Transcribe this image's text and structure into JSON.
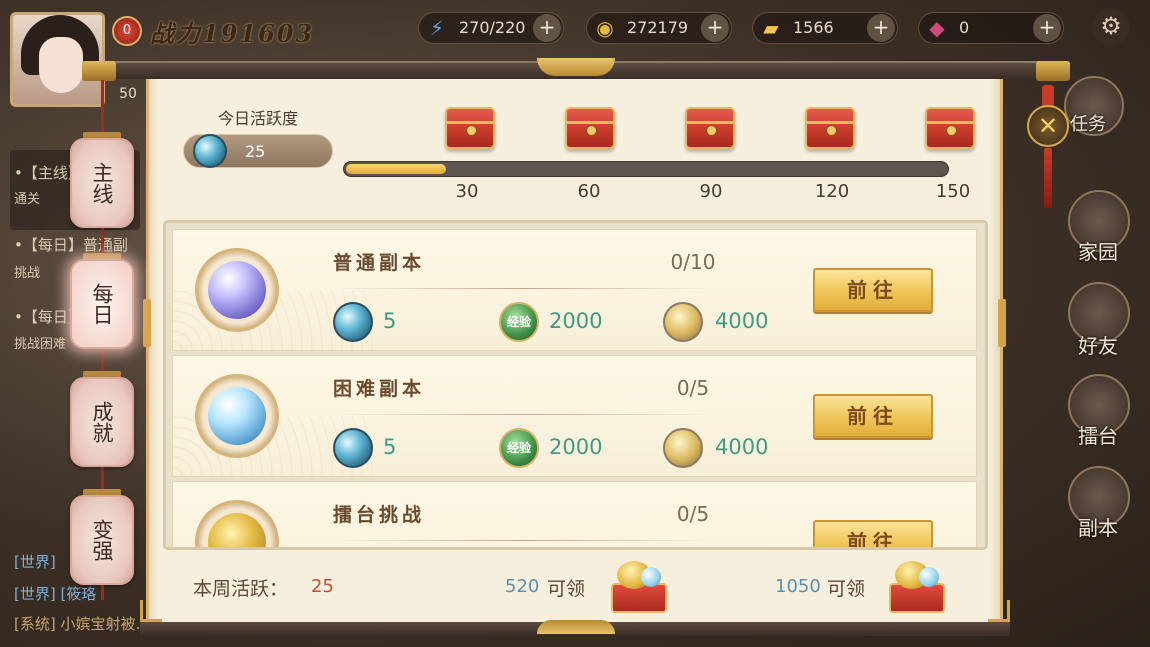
{
  "hud": {
    "power_badge": "0",
    "power_value": "战力191603",
    "level": "50",
    "resources": [
      {
        "icon": "lightning-icon",
        "value": "270/220"
      },
      {
        "icon": "coin-icon",
        "value": "272179"
      },
      {
        "icon": "gold-ingot-icon",
        "value": "1566"
      },
      {
        "icon": "gem-icon",
        "value": "0"
      }
    ]
  },
  "chat": {
    "lines": [
      "•【主线】",
      "通关",
      "•【每日】普通副",
      "挑战",
      "•【每日】",
      "挑战困难"
    ],
    "bottom_lines": [
      "[世界]",
      "[世界] [筱珞",
      "[系统] 小嫔宝射被…"
    ]
  },
  "side_menu": {
    "buttons": [
      {
        "label": "家园",
        "icon": "home-icon"
      },
      {
        "label": "好友",
        "icon": "friends-icon"
      },
      {
        "label": "擂台",
        "icon": "arena-icon"
      },
      {
        "label": "副本",
        "icon": "dungeon-icon"
      }
    ],
    "top_button": "任务"
  },
  "tabs": [
    {
      "label": "主线",
      "active": false
    },
    {
      "label": "每日",
      "active": true
    },
    {
      "label": "成就",
      "active": false
    },
    {
      "label": "变强",
      "active": false
    }
  ],
  "activity": {
    "title": "今日活跃度",
    "value": "25",
    "progress_fraction": 0.167,
    "milestones": [
      "30",
      "60",
      "90",
      "120",
      "150"
    ]
  },
  "tasks": [
    {
      "name": "普通副本",
      "progress": "0/10",
      "icon": "purple-orb-icon",
      "rewards": {
        "orb": "5",
        "exp": "2000",
        "coin": "4000"
      },
      "exp_label": "经验",
      "button": "前往"
    },
    {
      "name": "困难副本",
      "progress": "0/5",
      "icon": "blue-crystal-orb-icon",
      "rewards": {
        "orb": "5",
        "exp": "2000",
        "coin": "4000"
      },
      "exp_label": "经验",
      "button": "前往"
    },
    {
      "name": "擂台挑战",
      "progress": "0/5",
      "icon": "arena-token-icon",
      "rewards": {
        "orb": "",
        "exp": "",
        "coin": ""
      },
      "exp_label": "",
      "button": "前往"
    }
  ],
  "weekly": {
    "label": "本周活跃：",
    "value": "25",
    "rewards": [
      {
        "threshold": "520",
        "claim": "可领"
      },
      {
        "threshold": "1050",
        "claim": "可领"
      }
    ]
  },
  "colors": {
    "panel_bg": "#f6efdd",
    "gold": "#e2ad3b",
    "accent_red": "#c84a3a",
    "reward_teal": "#3f9a86",
    "threshold_blue": "#5c8fb0"
  }
}
